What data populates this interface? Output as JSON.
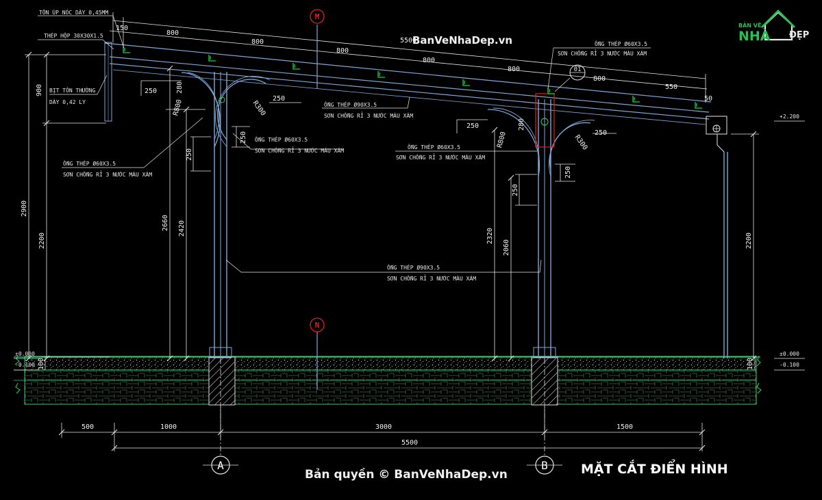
{
  "drawing_title": "MẶT CẮT ĐIỂN HÌNH",
  "watermark_top": "BanVeNhaDep.vn",
  "watermark_bottom": "Bản quyền © BanVeNhaDep.vn",
  "logo": {
    "line1": "BẢN VẼ",
    "brand_a": "NHÀ",
    "brand_b": "ĐẸP"
  },
  "section_markers": {
    "top": "M",
    "bottom": "N",
    "detail": "01"
  },
  "axis_labels": [
    "A",
    "B"
  ],
  "roof_dims": [
    "150",
    "800",
    "800",
    "800",
    "800",
    "800",
    "800",
    "550",
    "50"
  ],
  "roof_total": "5500",
  "bottom_dims": [
    "500",
    "1000",
    "3000",
    "1500"
  ],
  "bottom_total": "5500",
  "vertical_dims": {
    "left_900": "900",
    "left_2900": "2900",
    "left_2200": "2200",
    "col_a_2660": "2660",
    "col_a_2420": "2420",
    "col_a_250": "250",
    "col_b_2320": "2320",
    "col_b_2060": "2060",
    "col_b_250": "250",
    "right_2200": "2200",
    "base_left_100": "100",
    "base_right_100": "100"
  },
  "bracket_dims": {
    "a_250_left": "250",
    "a_280": "280",
    "a_250_right": "250",
    "a_250_mid": "250",
    "b_250_left": "250",
    "b_280": "280",
    "b_250_right": "250",
    "b_250_mid": "250"
  },
  "radius_labels": [
    "R800",
    "R300",
    "R800",
    "R300"
  ],
  "levels": {
    "left_top": "±0.000",
    "left_bottom": "-0.100",
    "right_top": "±0.000",
    "right_bottom": "-0.100",
    "right_roof": "+2.200"
  },
  "notes": {
    "ridge_cap": "TÔN ÚP NÓC DÀY 0,45MM",
    "box_steel": "THÉP HỘP 30X30X1.5",
    "fascia_1": "BỊT TÔN THƯỜNG",
    "fascia_2": "DÀY 0,42 LY",
    "pipe60_b_1": "ỐNG THÉP Ø60X3.5",
    "pipe60_b_2": "SƠN CHỐNG RỈ 3 NƯỚC MÀU XÁM",
    "pipe90_top_1": "ỐNG THÉP Ø90X3.5",
    "pipe90_top_2": "SƠN CHỐNG RỈ 3 NƯỚC MÀU XÁM",
    "pipe60_a_1": "ỐNG THÉP Ø60X3.5",
    "pipe60_a_2": "SƠN CHỐNG RỈ 3 NƯỚC MÀU XÁM",
    "pipe60_mid_1": "ỐNG THÉP Ø60X3.5",
    "pipe60_mid_2": "SƠN CHỐNG RỈ 3 NƯỚC MÀU XÁM",
    "pipe60_left_1": "ỐNG THÉP Ø60X3.5",
    "pipe60_left_2": "SƠN CHỐNG RỈ 3 NƯỚC MÀU XÁM",
    "pipe90_mid_1": "ỐNG THÉP Ø90X3.5",
    "pipe90_mid_2": "SƠN CHỐNG RỈ 3 NƯỚC MÀU XÁM"
  },
  "colors": {
    "background": "#000000",
    "structure": "#7fa8d6",
    "ground": "#2fd16a",
    "dimension": "#e9e9e9",
    "marker_red": "#e01e1e",
    "purlin": "#1fcf48",
    "logo_green": "#2bbf52"
  }
}
